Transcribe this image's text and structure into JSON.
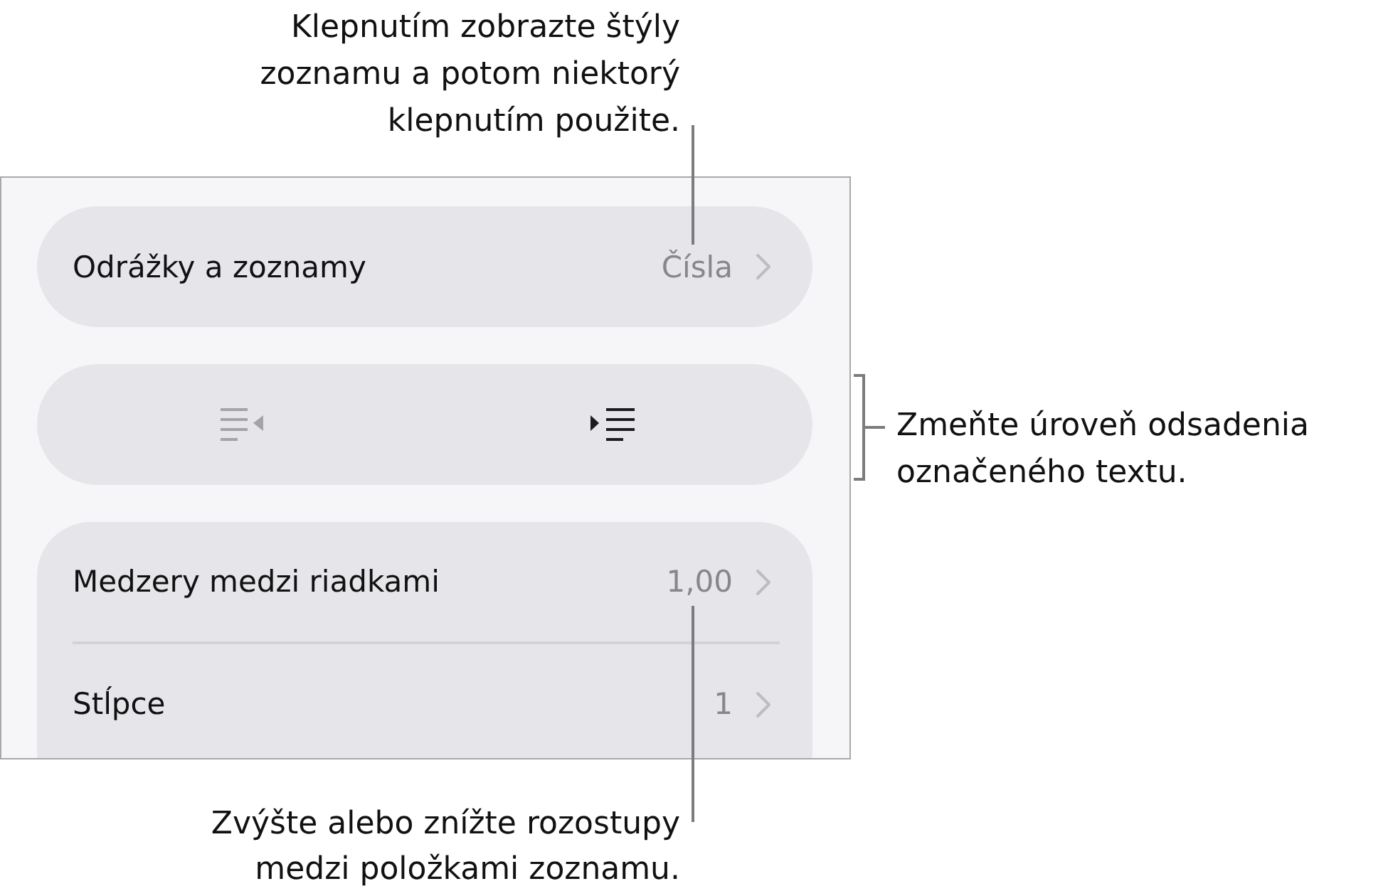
{
  "panel": {
    "rows": [
      {
        "label": "Odrážky a zoznamy",
        "value": "Čísla"
      }
    ],
    "indent_buttons": [
      {
        "kind": "decrease",
        "disabled": true
      },
      {
        "kind": "increase",
        "disabled": false
      }
    ],
    "group_rows": [
      {
        "label": "Medzery medzi riadkami",
        "value": "1,00"
      },
      {
        "label": "Stĺpce",
        "value": "1"
      }
    ]
  },
  "callouts": [
    {
      "kind": "leader",
      "lines": [
        "Klepnutím zobrazte štýly",
        "zoznamu a potom niektorý",
        "klepnutím použite."
      ]
    },
    {
      "kind": "bracket",
      "lines": [
        "Zmeňte úroveň odsadenia",
        "označeného textu."
      ]
    },
    {
      "kind": "leader",
      "lines": [
        "Zvýšte alebo znížte rozostupy",
        "medzi položkami zoznamu."
      ]
    }
  ]
}
